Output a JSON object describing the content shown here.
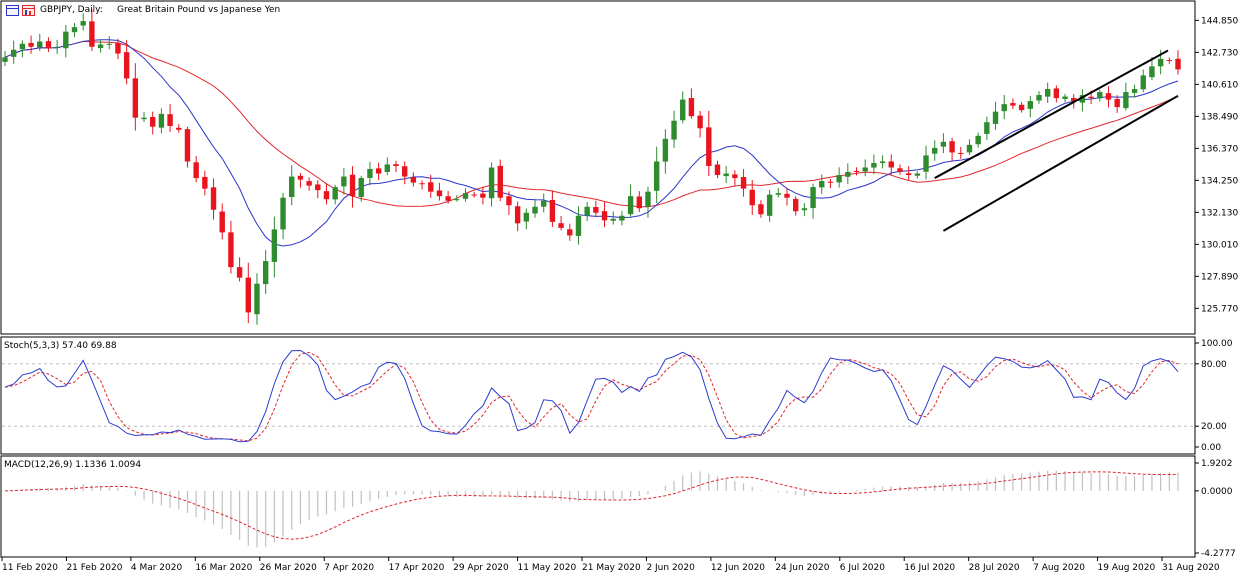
{
  "header": {
    "symbol_label": "GBPJPY, Daily:",
    "description": "Great Britain Pound vs Japanese Yen"
  },
  "stoch": {
    "label": "Stoch(5,3,3) 57.40 69.88",
    "levels": [
      "100.00",
      "80.00",
      "20.00",
      "0.00"
    ]
  },
  "macd": {
    "label": "MACD(12,26,9) 1.1336 1.0094",
    "levels": [
      "1.9202",
      "0.0000",
      "-4.2777"
    ]
  },
  "colors": {
    "bull": "#2e8b2e",
    "bear": "#e8141e",
    "ma_fast": "#2b35c8",
    "ma_slow": "#e0282e",
    "stoch_main": "#2d3ccf",
    "stoch_signal": "#e0282e",
    "macd_hist": "#c0c0c0",
    "macd_signal": "#e0282e",
    "channel": "#000000"
  },
  "chart_data": {
    "type": "candlestick",
    "price_axis": {
      "ticks": [
        "144.850",
        "142.730",
        "140.610",
        "138.490",
        "136.370",
        "134.250",
        "132.130",
        "130.010",
        "127.890",
        "125.770"
      ],
      "range": [
        124.2,
        146.0
      ]
    },
    "date_labels": [
      "11 Feb 2020",
      "21 Feb 2020",
      "4 Mar 2020",
      "16 Mar 2020",
      "26 Mar 2020",
      "7 Apr 2020",
      "17 Apr 2020",
      "29 Apr 2020",
      "11 May 2020",
      "21 May 2020",
      "2 Jun 2020",
      "12 Jun 2020",
      "24 Jun 2020",
      "6 Jul 2020",
      "16 Jul 2020",
      "28 Jul 2020",
      "7 Aug 2020",
      "19 Aug 2020",
      "31 Aug 2020"
    ],
    "closes": [
      142.4,
      142.9,
      143.3,
      143.1,
      143.45,
      143.0,
      143.1,
      144.1,
      144.4,
      144.8,
      143.1,
      143.25,
      143.3,
      142.65,
      141.0,
      138.4,
      138.4,
      137.8,
      138.65,
      137.85,
      137.6,
      135.5,
      134.4,
      133.7,
      132.3,
      130.8,
      128.5,
      127.8,
      125.5,
      127.4,
      128.9,
      131.0,
      133.1,
      134.5,
      134.3,
      133.9,
      133.6,
      133.0,
      133.8,
      134.5,
      133.2,
      134.4,
      135.0,
      134.7,
      135.3,
      135.2,
      134.5,
      134.1,
      134.0,
      133.5,
      133.2,
      132.9,
      133.0,
      133.4,
      133.3,
      133.1,
      135.1,
      133.1,
      132.6,
      131.4,
      132.1,
      132.5,
      132.9,
      131.5,
      131.1,
      130.6,
      131.9,
      132.5,
      132.1,
      131.6,
      131.7,
      131.9,
      133.2,
      132.4,
      133.5,
      135.5,
      137.0,
      138.2,
      139.6,
      138.5,
      137.7,
      135.2,
      134.6,
      134.7,
      134.4,
      133.7,
      132.6,
      132.0,
      133.3,
      133.4,
      133.1,
      132.2,
      132.4,
      133.8,
      134.2,
      134.1,
      134.6,
      134.8,
      134.8,
      135.1,
      135.4,
      135.5,
      135.1,
      134.8,
      134.6,
      134.7,
      135.9,
      136.4,
      136.8,
      136.1,
      136.0,
      136.6,
      137.2,
      138.1,
      138.8,
      139.3,
      139.2,
      138.9,
      139.5,
      139.9,
      140.3,
      139.7,
      139.8,
      139.5,
      139.9,
      139.7,
      140.1,
      139.6,
      139.1,
      140.1,
      140.3,
      141.2,
      141.8,
      142.3,
      142.2,
      141.6
    ]
  }
}
